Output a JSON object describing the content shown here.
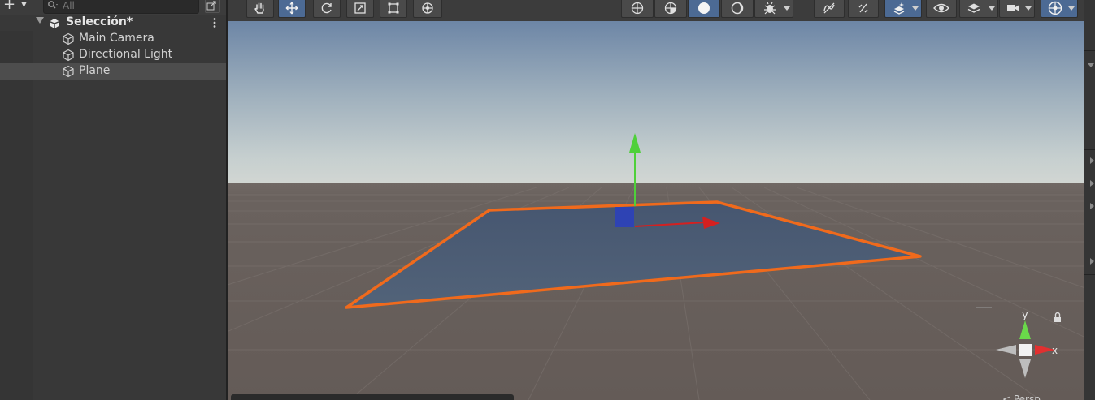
{
  "hierarchy": {
    "add_label": "+",
    "search_placeholder": "All",
    "scene_name": "Selección*",
    "items": [
      {
        "label": "Main Camera",
        "selected": false
      },
      {
        "label": "Directional Light",
        "selected": false
      },
      {
        "label": "Plane",
        "selected": true
      }
    ]
  },
  "scene_toolbar": {
    "tools": [
      "hand-tool-icon",
      "move-tool-icon",
      "rotate-tool-icon",
      "scale-tool-icon",
      "rect-tool-icon",
      "transform-tool-icon"
    ],
    "active_tool": "move-tool-icon",
    "shading": [
      "wireframe-icon",
      "shaded-wireframe-icon",
      "shaded-icon",
      "unlit-icon"
    ],
    "active_shading": "shaded-icon",
    "right_tools": [
      "debug-bug-icon",
      "2d-toggle-icon",
      "lighting-toggle-icon",
      "effects-icon",
      "visibility-eye-icon",
      "layers-icon",
      "camera-icon",
      "gizmos-icon"
    ]
  },
  "gizmo": {
    "y_label": "y",
    "x_label": "x",
    "bottom_text": "< Persp"
  },
  "colors": {
    "selection_outline": "#f06a1c",
    "plane": "#4a5a73",
    "axis_x": "#d42020",
    "axis_y": "#4fd03a",
    "axis_z": "#2a3fc0",
    "active_tool_bg": "#4c6a94"
  }
}
